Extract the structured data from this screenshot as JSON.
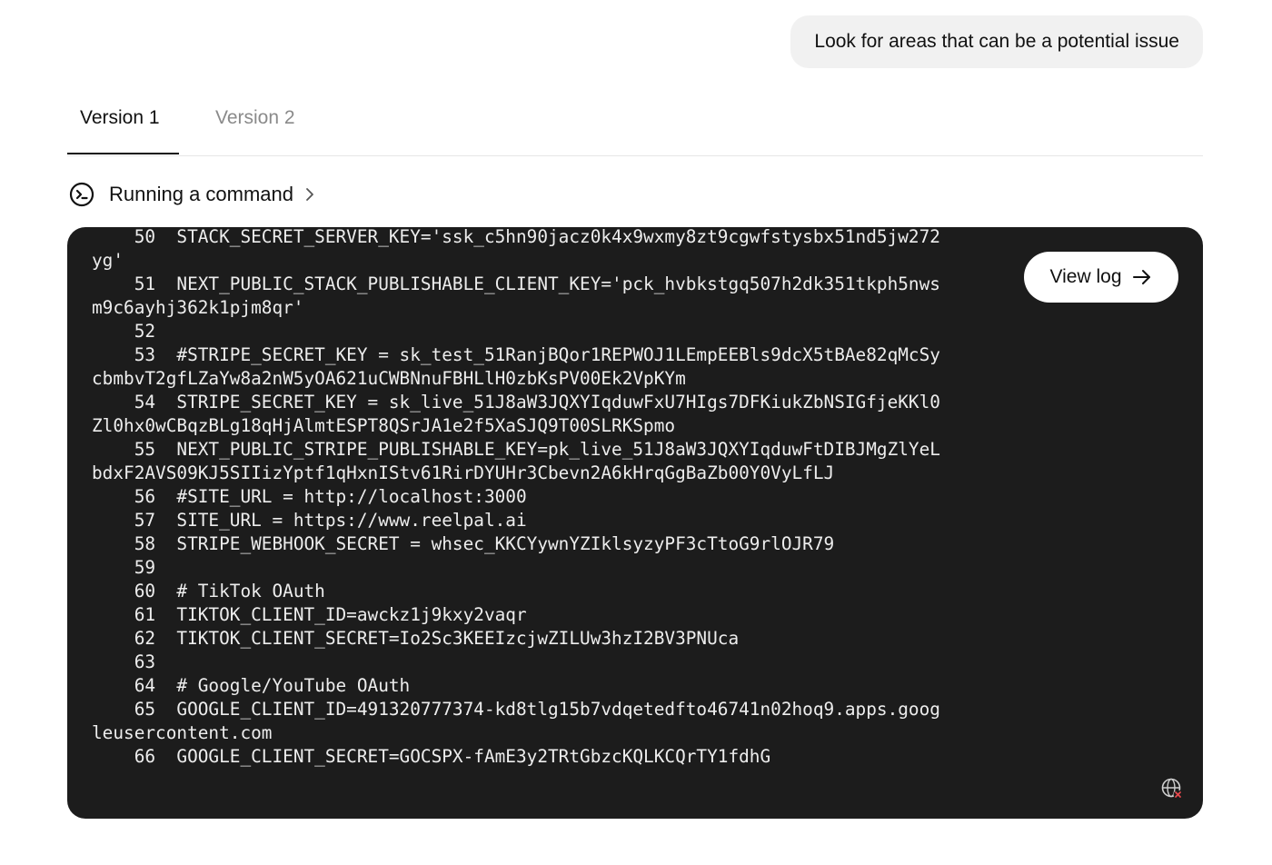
{
  "user_message": "Look for areas that can be a potential issue",
  "tabs": [
    {
      "label": "Version 1",
      "active": true
    },
    {
      "label": "Version 2",
      "active": false
    }
  ],
  "command": {
    "label": "Running a command",
    "icon": "terminal-icon",
    "chevron": "chevron-right-icon"
  },
  "terminal": {
    "view_log_label": "View log",
    "view_log_icon": "arrow-right-icon",
    "status_icon": "globe-off-icon",
    "lines": [
      "    50  STACK_SECRET_SERVER_KEY='ssk_c5hn90jacz0k4x9wxmy8zt9cgwfstysbx51nd5jw272yg'",
      "    51  NEXT_PUBLIC_STACK_PUBLISHABLE_CLIENT_KEY='pck_hvbkstgq507h2dk351tkph5nwsm9c6ayhj362k1pjm8qr'",
      "    52",
      "    53  #STRIPE_SECRET_KEY = sk_test_51RanjBQor1REPWOJ1LEmpEEBls9dcX5tBAe82qMcSycbmbvT2gfLZaYw8a2nW5yOA621uCWBNnuFBHLlH0zbKsPV00Ek2VpKYm",
      "    54  STRIPE_SECRET_KEY = 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",
      "    55  NEXT_PUBLIC_STRIPE_PUBLISHABLE_KEY=pk_live_51J8aW3JQXYIqduwFtDIBJMgZlYeLbdxF2AVS09KJ5SIIizYptf1qHxnIStv61RirDYUHr3Cbevn2A6kHrqGgBaZb00Y0VyLfLJ",
      "    56  #SITE_URL = http://localhost:3000",
      "    57  SITE_URL = https://www.reelpal.ai",
      "    58  STRIPE_WEBHOOK_SECRET = whsec_KKCYywnYZIklsyzyPF3cTtoG9rlOJR79",
      "    59",
      "    60  # TikTok OAuth",
      "    61  TIKTOK_CLIENT_ID=awckz1j9kxy2vaqr",
      "    62  TIKTOK_CLIENT_SECRET=Io2Sc3KEEIzcjwZILUw3hzI2BV3PNUca",
      "    63",
      "    64  # Google/YouTube OAuth",
      "    65  GOOGLE_CLIENT_ID=491320777374-kd8tlg15b7vdqetedfto46741n02hoq9.apps.googleusercontent.com",
      "    66  GOOGLE_CLIENT_SECRET=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"
    ]
  }
}
